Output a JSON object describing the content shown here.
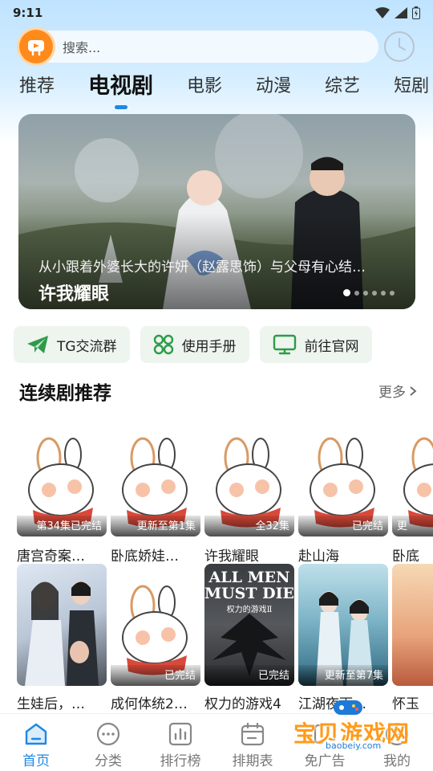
{
  "status": {
    "time": "9:11"
  },
  "search": {
    "placeholder": "搜索..."
  },
  "tabs": [
    {
      "label": "推荐"
    },
    {
      "label": "电视剧",
      "active": true
    },
    {
      "label": "电影"
    },
    {
      "label": "动漫"
    },
    {
      "label": "综艺"
    },
    {
      "label": "短剧"
    }
  ],
  "banner": {
    "description": "从小跟着外婆长大的许妍（赵露思饰）与父母有心结…",
    "title": "许我耀眼",
    "slide_count": 6,
    "active_slide": 1
  },
  "quick_actions": [
    {
      "label": "TG交流群",
      "icon": "telegram-icon"
    },
    {
      "label": "使用手册",
      "icon": "grid-icon"
    },
    {
      "label": "前往官网",
      "icon": "monitor-icon"
    }
  ],
  "section": {
    "title": "连续剧推荐",
    "more_label": "更多"
  },
  "row1": [
    {
      "title": "唐宫奇案…",
      "badge": "第34集已完结"
    },
    {
      "title": "卧底娇娃…",
      "badge": "更新至第1集"
    },
    {
      "title": "许我耀眼",
      "badge": "全32集"
    },
    {
      "title": "赴山海",
      "badge": "已完结"
    },
    {
      "title": "卧底",
      "badge": "更"
    }
  ],
  "row2": [
    {
      "title": "生娃后，…",
      "badge": ""
    },
    {
      "title": "成何体统2…",
      "badge": "已完结"
    },
    {
      "title": "权力的游戏4",
      "badge": "已完结",
      "poster_line1": "ALL MEN",
      "poster_line2": "MUST DIE",
      "poster_line3": "权力的游戏Ⅱ"
    },
    {
      "title": "江湖夜雨…",
      "badge": "更新至第7集"
    },
    {
      "title": "怀玉",
      "badge": ""
    }
  ],
  "bottom_nav": [
    {
      "label": "首页",
      "icon": "home-icon",
      "active": true
    },
    {
      "label": "分类",
      "icon": "category-icon"
    },
    {
      "label": "排行榜",
      "icon": "ranking-icon"
    },
    {
      "label": "排期表",
      "icon": "calendar-icon"
    },
    {
      "label": "免广告",
      "icon": "ad-free-icon"
    },
    {
      "label": "我的",
      "icon": "profile-icon"
    }
  ],
  "watermark": {
    "main": "宝贝游戏网",
    "sub": "baobeiy.com"
  },
  "colors": {
    "accent": "#1e88e5",
    "logo": "#ff8a1c",
    "quick_bg": "#eef4ee"
  }
}
